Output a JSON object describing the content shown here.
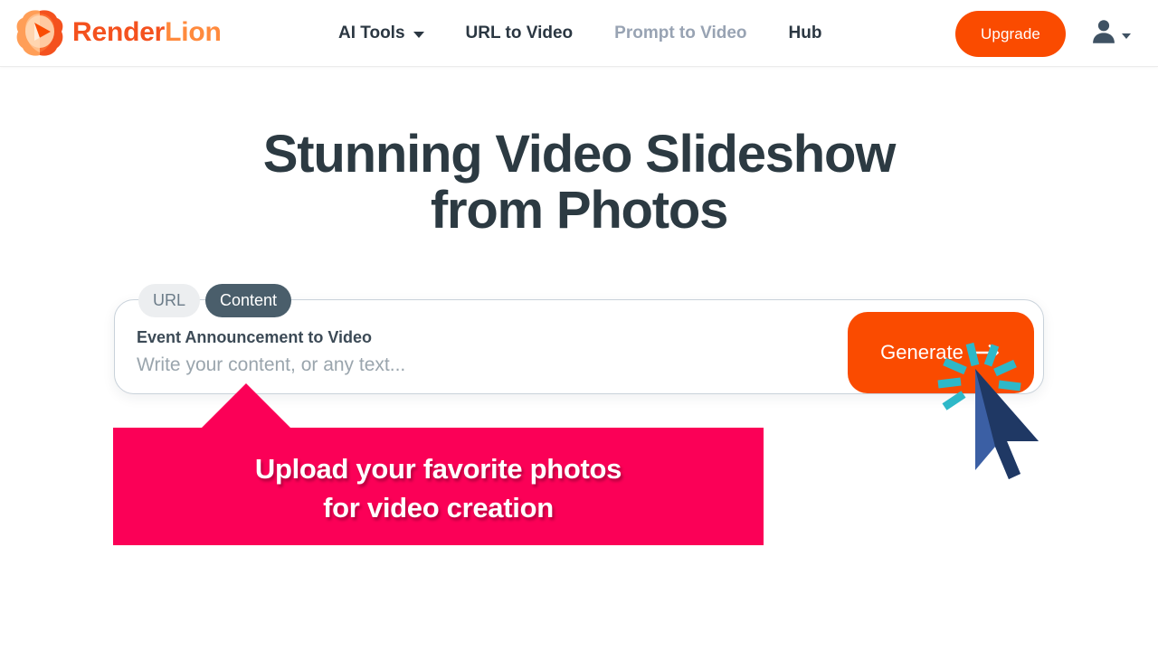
{
  "header": {
    "logo": {
      "icon": "lion-play-logo-icon",
      "text_primary": "Render",
      "text_secondary": "Lion"
    },
    "nav": [
      {
        "label": "AI Tools",
        "has_dropdown": true,
        "muted": false,
        "icon": "chevron-down-icon"
      },
      {
        "label": "URL to Video",
        "has_dropdown": false,
        "muted": false
      },
      {
        "label": "Prompt to Video",
        "has_dropdown": false,
        "muted": true
      },
      {
        "label": "Hub",
        "has_dropdown": false,
        "muted": false
      }
    ],
    "upgrade_label": "Upgrade",
    "account": {
      "icon": "user-avatar-icon",
      "caret_icon": "chevron-down-icon"
    }
  },
  "hero": {
    "title_line1": "Stunning Video Slideshow",
    "title_line2": "from Photos"
  },
  "generator": {
    "tabs": [
      {
        "label": "URL",
        "active": false
      },
      {
        "label": "Content",
        "active": true
      }
    ],
    "field_label": "Event Announcement to Video",
    "placeholder": "Write your content, or any text...",
    "generate_label": "Generate",
    "generate_arrow_icon": "arrow-right-icon"
  },
  "callout": {
    "line1": "Upload your favorite photos",
    "line2": "for video creation"
  },
  "cursor": {
    "icon": "mouse-pointer-icon",
    "effect": "click-burst"
  },
  "colors": {
    "brand_orange": "#F4511E",
    "brand_orange_light": "#FF8A3D",
    "accent_orange": "#FA4B00",
    "callout_pink": "#FB0057",
    "tab_active_slate": "#4A5E6B",
    "heading_dark": "#2C3A42",
    "nav_muted": "#98A3B3",
    "burst_cyan": "#2EB8C8",
    "cursor_dark": "#1F3864",
    "cursor_light": "#3B5FA4"
  }
}
